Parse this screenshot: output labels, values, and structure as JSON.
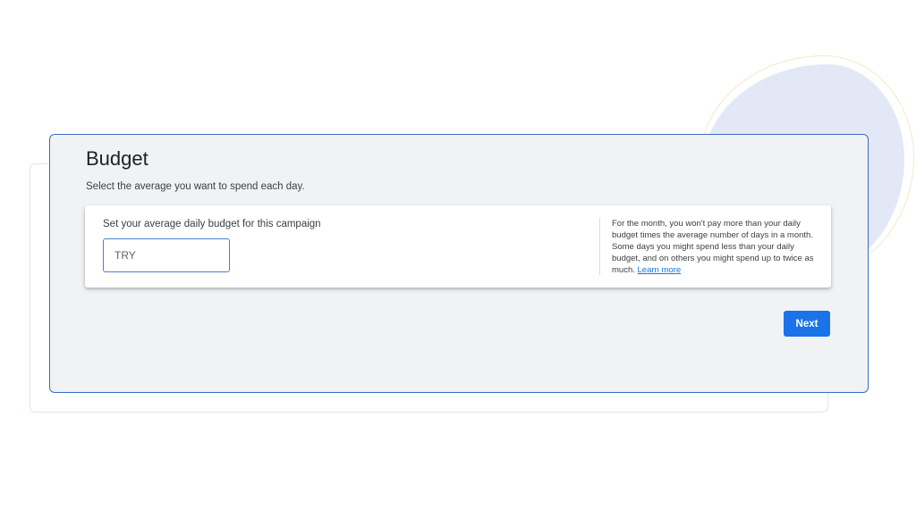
{
  "budget": {
    "title": "Budget",
    "subtitle": "Select the average you want to spend each day.",
    "panel": {
      "label": "Set your average daily budget for this campaign",
      "input_value": "TRY",
      "help_text": "For the month, you won't pay more than your daily budget times the average number of days in a month. Some days you might spend less than your daily budget, and on others you might spend up to twice as much.",
      "learn_more": "Learn more"
    },
    "next_label": "Next"
  },
  "colors": {
    "accent": "#1a73e8",
    "card_background": "#f1f2f4",
    "card_border": "#3c6cc7",
    "decor_blob": "#e3e8f6"
  }
}
